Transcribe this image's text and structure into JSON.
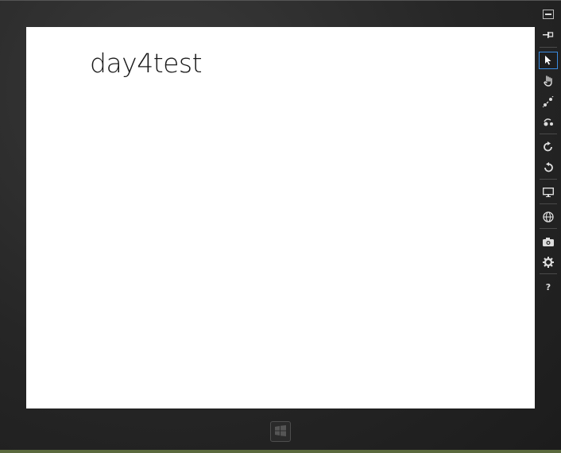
{
  "app": {
    "title": "day4test"
  },
  "toolbar": {
    "items": [
      {
        "name": "minimize",
        "icon": "minimize-icon"
      },
      {
        "name": "always-on-top",
        "icon": "pin-icon"
      },
      {
        "name": "mouse-mode",
        "icon": "mouse-pointer-icon",
        "selected": true
      },
      {
        "name": "basic-touch-mode",
        "icon": "hand-icon"
      },
      {
        "name": "pinch-zoom-touch-mode",
        "icon": "pinch-icon"
      },
      {
        "name": "rotation-touch-mode",
        "icon": "rotation-touch-icon"
      },
      {
        "name": "rotate-clockwise",
        "icon": "rotate-clockwise-icon"
      },
      {
        "name": "rotate-counterclockwise",
        "icon": "rotate-counterclockwise-icon"
      },
      {
        "name": "change-resolution",
        "icon": "monitor-icon"
      },
      {
        "name": "set-location",
        "icon": "globe-icon"
      },
      {
        "name": "screenshot",
        "icon": "camera-icon"
      },
      {
        "name": "network-settings",
        "icon": "gear-icon"
      },
      {
        "name": "help",
        "icon": "help-icon",
        "label": "?"
      }
    ]
  },
  "colors": {
    "accent": "#3a8be0",
    "screen": "#ffffff",
    "frame": "#262626"
  },
  "windows_button": {
    "icon": "windows-logo-icon"
  }
}
